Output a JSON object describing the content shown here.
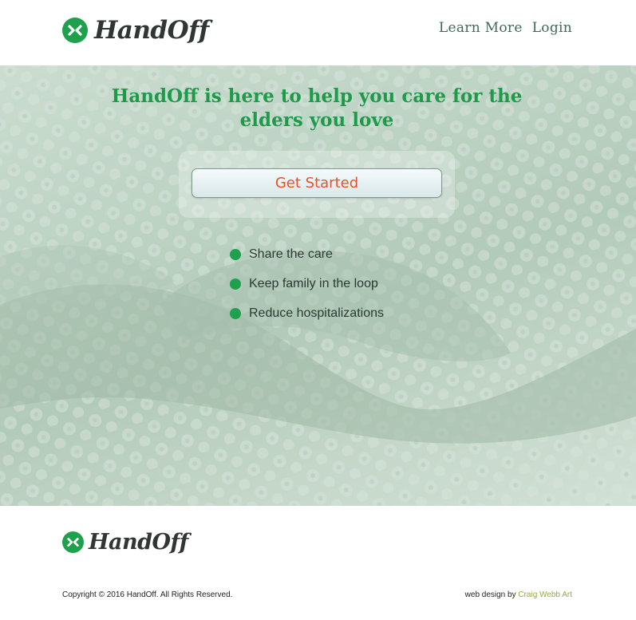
{
  "brand": {
    "name": "HandOff",
    "accent": "#1f9a4a",
    "mark_color": "#1fa04c"
  },
  "nav": {
    "learn_more": "Learn More",
    "login": "Login"
  },
  "hero": {
    "headline": "HandOff is here to help you care for the elders you love",
    "cta_label": "Get Started",
    "cta_color": "#e2532d",
    "features": [
      "Share the care",
      "Keep family in the loop",
      "Reduce hospitalizations"
    ]
  },
  "footer": {
    "brand": "HandOff",
    "copyright": "Copyright © 2016 HandOff. All Rights Reserved.",
    "credit_prefix": "web design by",
    "credit_link": "Craig Webb Art"
  }
}
